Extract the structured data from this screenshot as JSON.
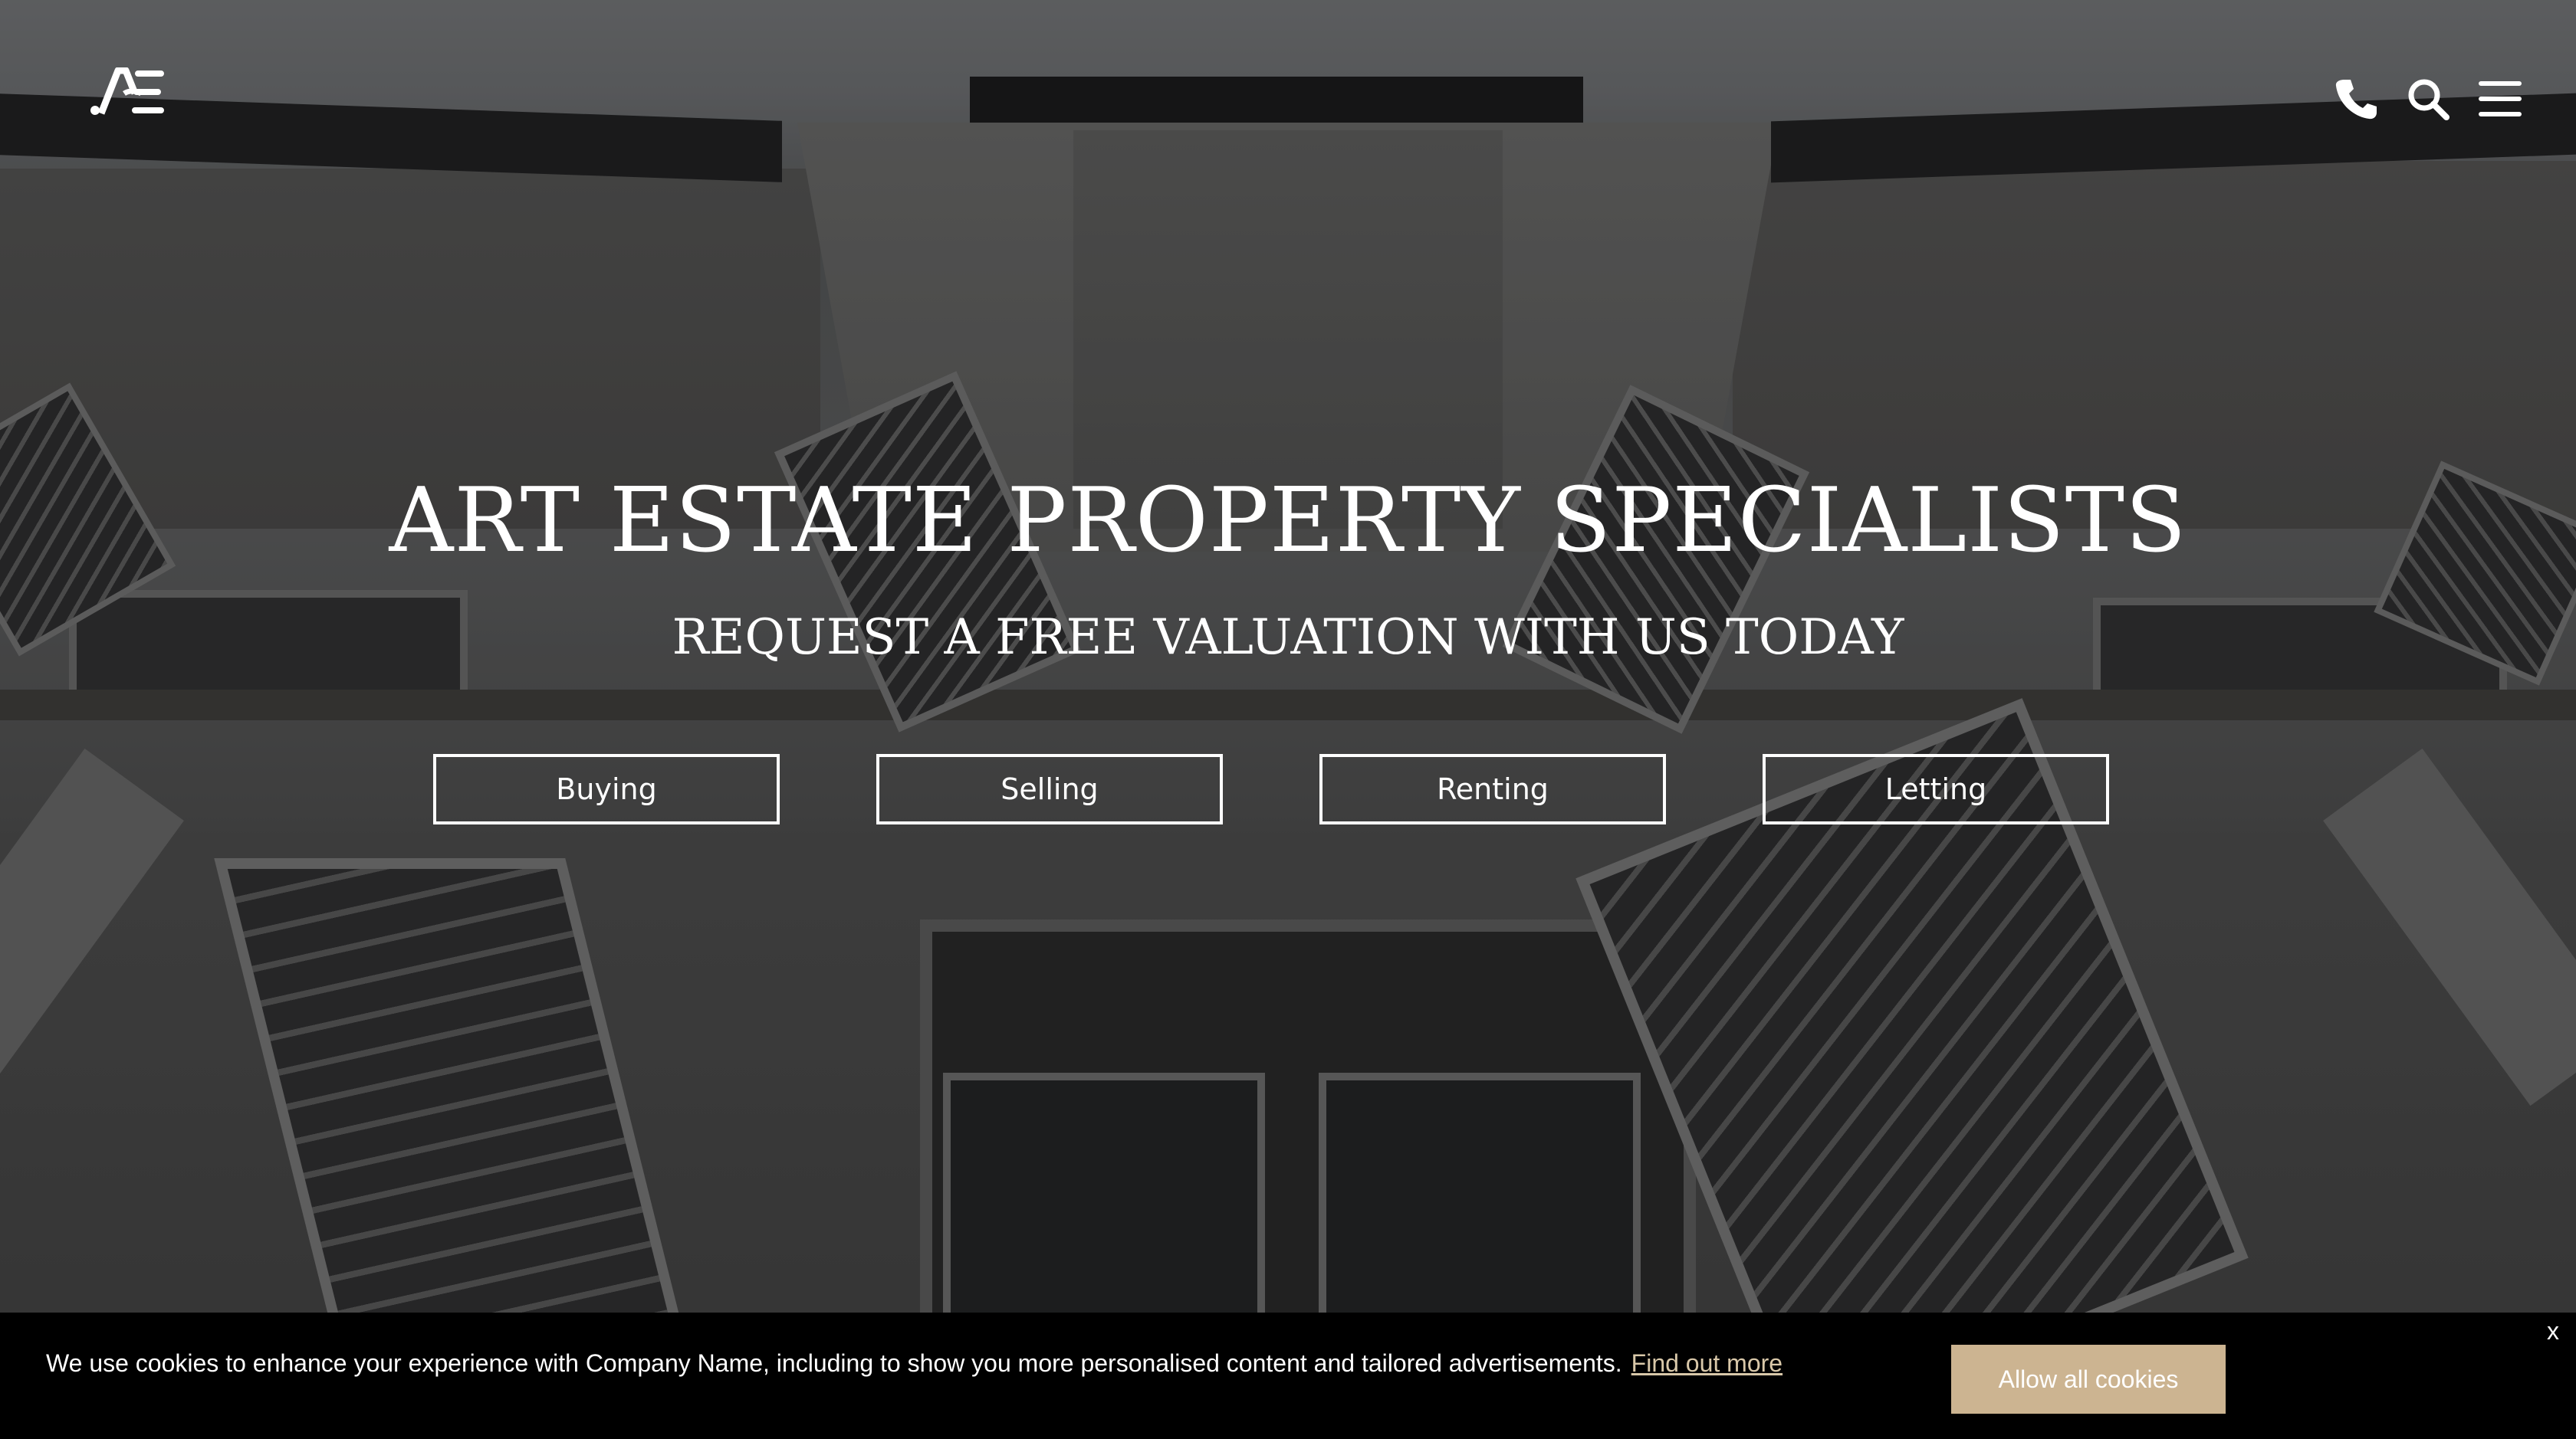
{
  "header": {
    "logo_text": "AE",
    "icons": [
      "phone-icon",
      "search-icon",
      "menu-icon"
    ]
  },
  "hero": {
    "title": "ART ESTATE PROPERTY SPECIALISTS",
    "subtitle": "REQUEST A FREE VALUATION WITH US TODAY",
    "buttons": [
      "Buying",
      "Selling",
      "Renting",
      "Letting"
    ]
  },
  "cookie": {
    "message": "We use cookies to enhance your experience with Company Name, including to show you more personalised content and tailored advertisements.",
    "link_label": "Find out more",
    "allow_label": "Allow all cookies",
    "close_label": "x"
  },
  "colors": {
    "accent": "#ccb491",
    "link": "#d9c8a9",
    "cookie_bg": "#000000"
  }
}
